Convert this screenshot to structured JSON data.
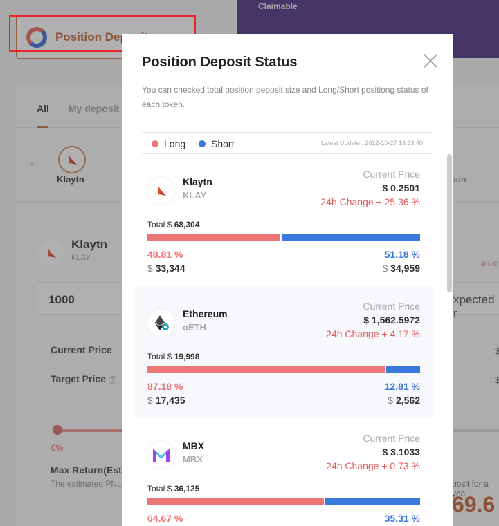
{
  "background": {
    "header_button_label": "Position Deposit",
    "claimable_label": "Claimable",
    "tabs": {
      "all": "All",
      "my_deposit": "My deposit"
    },
    "selected_token_name": "Klaytn",
    "chain_fragment": "ain",
    "detail_token_name": "Klaytn",
    "detail_token_symbol": "KLAY",
    "change_fragment": "24h C",
    "amount_value": "1000",
    "expected_fragment": "xpected r",
    "current_price_label": "Current Price",
    "target_price_label": "Target Price",
    "slider_value": "0%",
    "max_return_label": "Max Return(Esti",
    "estimated_pnl_label": "The estimated PNL",
    "deposit_fragment": "posit for a yea",
    "big_value_fragment": "69.6",
    "dollar_sign": "$"
  },
  "modal": {
    "title": "Position Deposit Status",
    "description": "You can checked total position deposit size and Long/Short positiong status of each token.",
    "legend": {
      "long": "Long",
      "short": "Short"
    },
    "latest_update": "Latest Update : 2022-10-27  16:33:40",
    "current_price_label": "Current Price",
    "change_label": "24h Change",
    "total_label": "Total",
    "tokens": [
      {
        "name": "Klaytn",
        "symbol": "KLAY",
        "price": "0.2501",
        "change": "+ 25.36 %",
        "total": "68,304",
        "long_pct": "48.81 %",
        "short_pct": "51.18 %",
        "long_amt": "33,344",
        "short_amt": "34,959",
        "long_ratio": 48.81
      },
      {
        "name": "Ethereum",
        "symbol": "oETH",
        "price": "1,562.5972",
        "change": "+ 4.17 %",
        "total": "19,998",
        "long_pct": "87.18 %",
        "short_pct": "12.81 %",
        "long_amt": "17,435",
        "short_amt": "2,562",
        "long_ratio": 87.18
      },
      {
        "name": "MBX",
        "symbol": "MBX",
        "price": "3.1033",
        "change": "+ 0.73 %",
        "total": "36,125",
        "long_pct": "64.67 %",
        "short_pct": "35.31 %",
        "long_amt": "",
        "short_amt": "",
        "long_ratio": 64.67
      }
    ]
  },
  "colors": {
    "long": "#ea7676",
    "short": "#3a78dd",
    "accent": "#c0541f",
    "purple": "#3c1f7a"
  }
}
